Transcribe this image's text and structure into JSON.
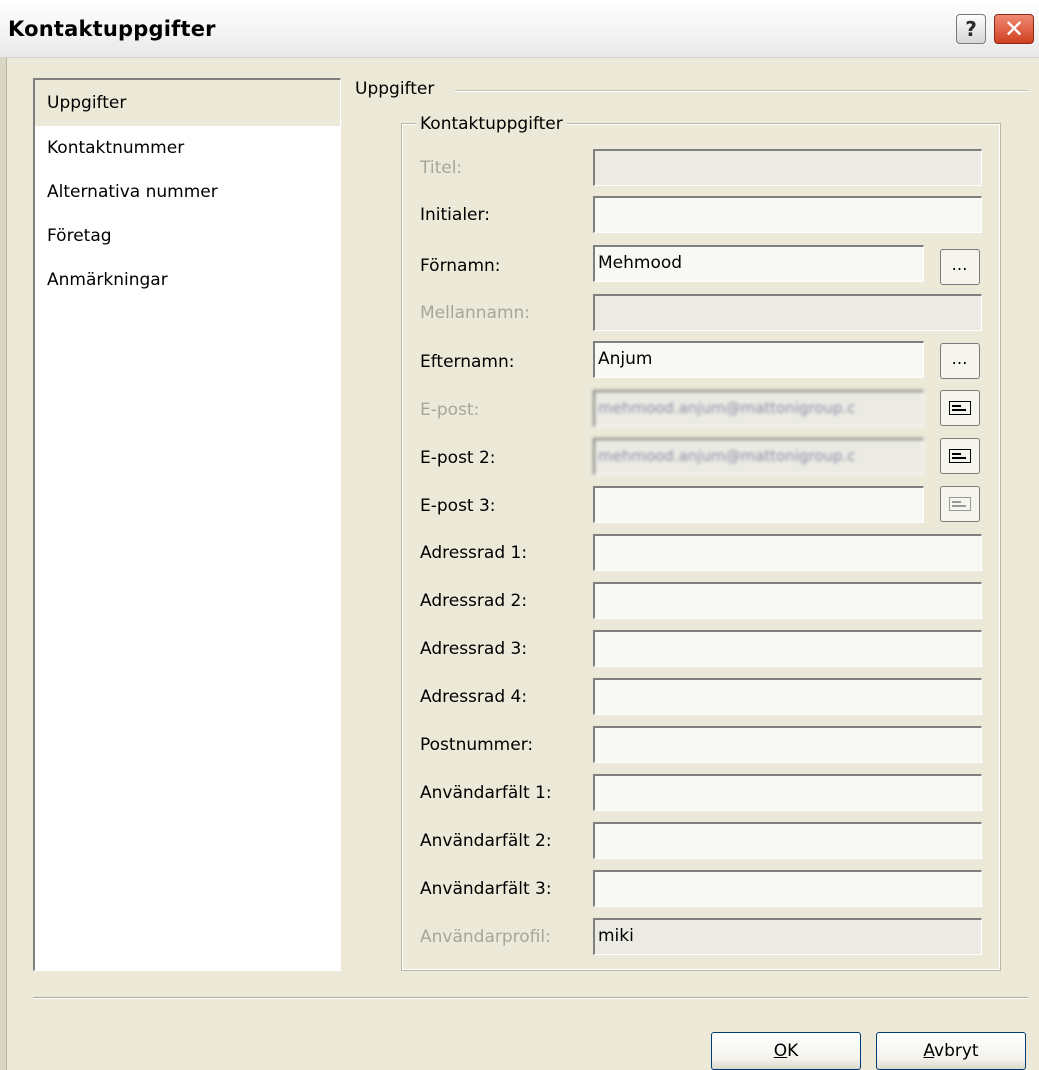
{
  "window": {
    "title": "Kontaktuppgifter",
    "help_glyph": "?",
    "close_glyph": "✕"
  },
  "nav": {
    "items": [
      {
        "label": "Uppgifter",
        "selected": true
      },
      {
        "label": "Kontaktnummer",
        "selected": false
      },
      {
        "label": "Alternativa nummer",
        "selected": false
      },
      {
        "label": "Företag",
        "selected": false
      },
      {
        "label": "Anmärkningar",
        "selected": false
      }
    ]
  },
  "section_title": "Uppgifter",
  "group_title": "Kontaktuppgifter",
  "fields": [
    {
      "label": "Titel:",
      "value": "",
      "enabled": false
    },
    {
      "label": "Initialer:",
      "value": "",
      "enabled": true
    },
    {
      "label": "Förnamn:",
      "value": "Mehmood",
      "enabled": true,
      "button": "…"
    },
    {
      "label": "Mellannamn:",
      "value": "",
      "enabled": false
    },
    {
      "label": "Efternamn:",
      "value": "Anjum",
      "enabled": true,
      "button": "…"
    },
    {
      "label": "E-post:",
      "value": "mehmood.anjum@mattonigroup.c",
      "enabled": false,
      "blurred": true,
      "button_icon": "send-mail-icon"
    },
    {
      "label": "E-post 2:",
      "value": "mehmood.anjum@mattonigroup.c",
      "enabled": true,
      "blurred": true,
      "button_icon": "send-mail-icon"
    },
    {
      "label": "E-post 3:",
      "value": "",
      "enabled": true,
      "button_icon": "send-mail-icon",
      "button_enabled": false
    },
    {
      "label": "Adressrad 1:",
      "value": "",
      "enabled": true
    },
    {
      "label": "Adressrad 2:",
      "value": "",
      "enabled": true
    },
    {
      "label": "Adressrad 3:",
      "value": "",
      "enabled": true
    },
    {
      "label": "Adressrad 4:",
      "value": "",
      "enabled": true
    },
    {
      "label": "Postnummer:",
      "value": "",
      "enabled": true
    },
    {
      "label": "Användarfält 1:",
      "value": "",
      "enabled": true
    },
    {
      "label": "Användarfält 2:",
      "value": "",
      "enabled": true
    },
    {
      "label": "Användarfält 3:",
      "value": "",
      "enabled": true
    },
    {
      "label": "Användarprofil:",
      "value": "miki",
      "enabled": false
    }
  ],
  "buttons": {
    "ok": {
      "mnemonic": "O",
      "rest": "K"
    },
    "cancel": {
      "mnemonic": "A",
      "rest": "vbryt"
    }
  }
}
